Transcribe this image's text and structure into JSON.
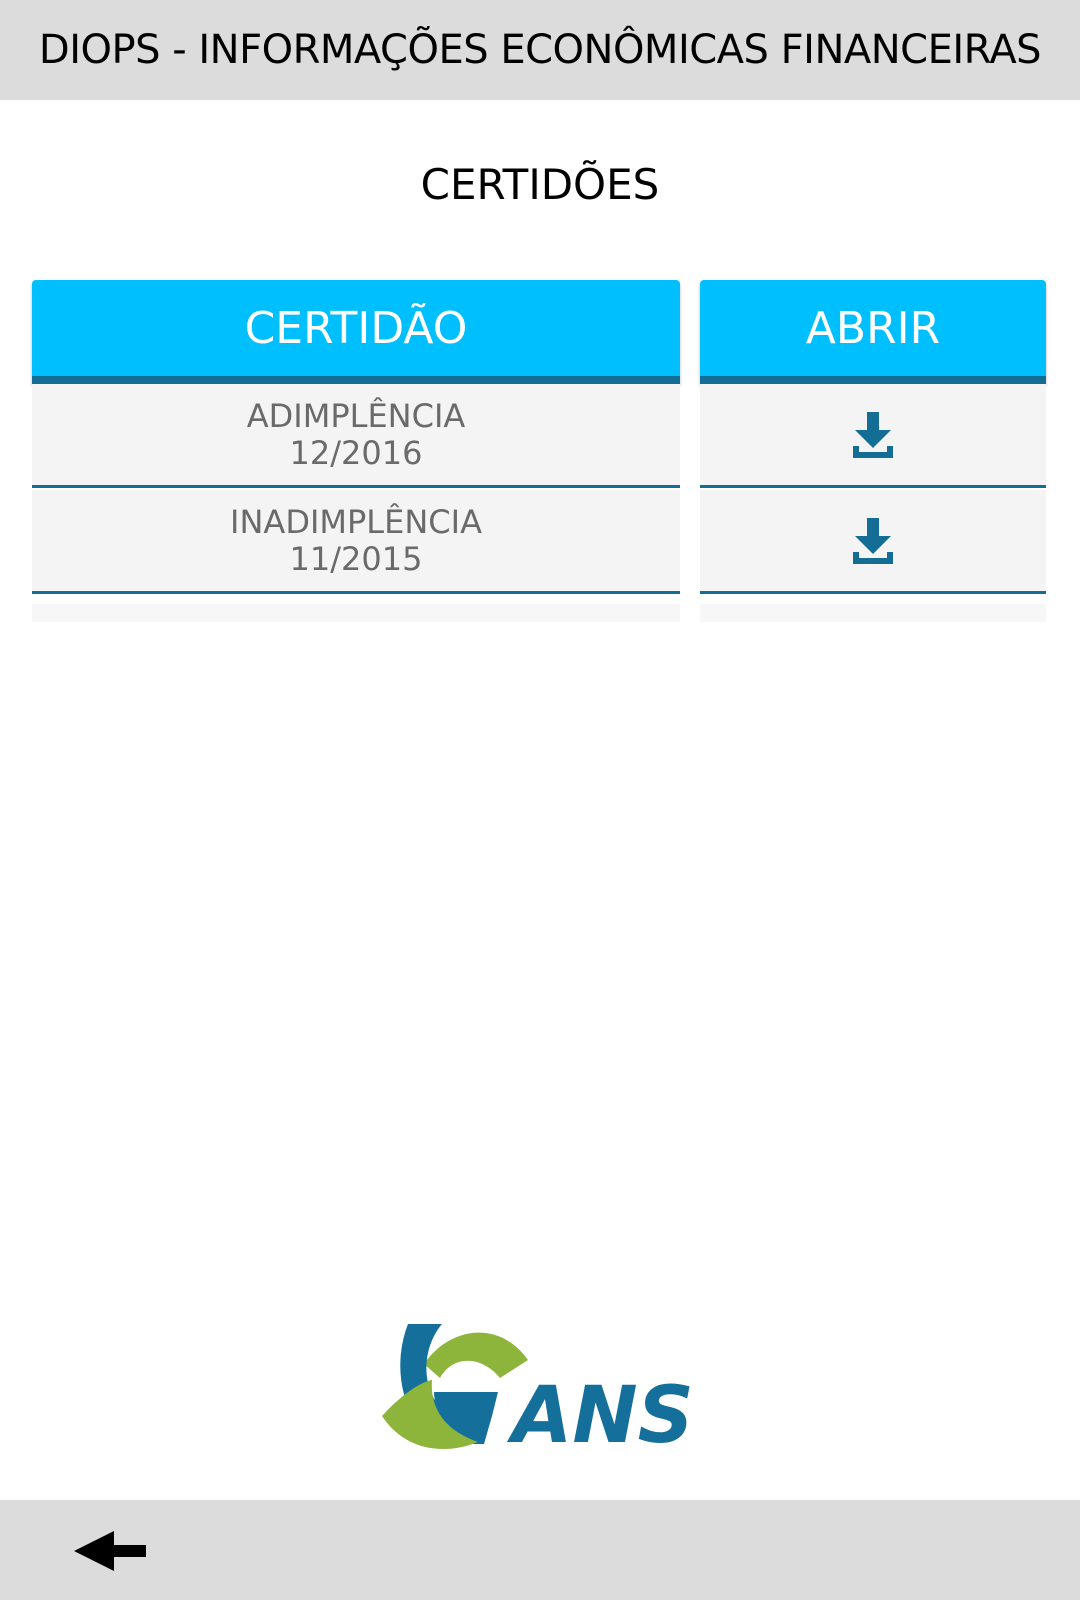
{
  "header": {
    "title": "DIOPS - INFORMAÇÕES ECONÔMICAS FINANCEIRAS"
  },
  "page": {
    "title": "CERTIDÕES"
  },
  "table": {
    "columns": {
      "certificate": "CERTIDÃO",
      "open": "ABRIR"
    },
    "rows": [
      {
        "name": "ADIMPLÊNCIA",
        "date": "12/2016",
        "action_icon": "download-icon"
      },
      {
        "name": "INADIMPLÊNCIA",
        "date": "11/2015",
        "action_icon": "download-icon"
      }
    ]
  },
  "logo": {
    "text": "ANS"
  },
  "footer": {
    "back_icon": "arrow-left-icon"
  },
  "colors": {
    "header_bg": "#dcdcdc",
    "accent": "#00bfff",
    "accent_dark": "#136d94",
    "row_bg": "#f4f4f4",
    "logo_green": "#8db53c",
    "logo_blue": "#14709a"
  }
}
